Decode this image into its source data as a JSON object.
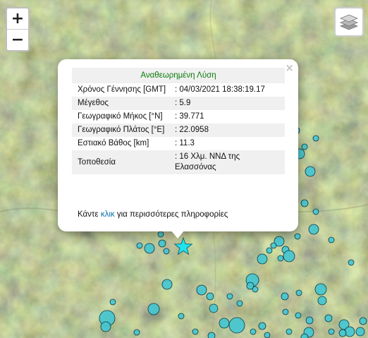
{
  "colors": {
    "marker_fill": "#45c6d0",
    "marker_stroke": "#0b3a44",
    "star_fill": "#21e3f0",
    "title_color": "#0a7a0a",
    "link_color": "#0b6fa8"
  },
  "controls": {
    "zoom_in_label": "+",
    "zoom_out_label": "−",
    "layers_icon": "layers-icon"
  },
  "popup": {
    "close_label": "×",
    "title": "Αναθεωρημένη Λύση",
    "rows": [
      {
        "label": "Χρόνος Γέννησης [GMT]",
        "value": ": 04/03/2021 18:38:19.17"
      },
      {
        "label": "Μέγεθος",
        "value": ": 5.9"
      },
      {
        "label": "Γεωγραφικό Μήκος [°N]",
        "value": ": 39.771"
      },
      {
        "label": "Γεωγραφικό Πλάτος [°E]",
        "value": ": 22.0958"
      },
      {
        "label": "Εστιακό Βάθος [km]",
        "value": ": 11.3"
      },
      {
        "label": "Τοποθεσία",
        "value": ": 16 Χλμ. ΝΝΔ της Ελασσόνας"
      }
    ],
    "footer_prefix": "Κάντε",
    "footer_link": "κλικ",
    "footer_suffix": "για περισσότερες πληροφορίες"
  }
}
